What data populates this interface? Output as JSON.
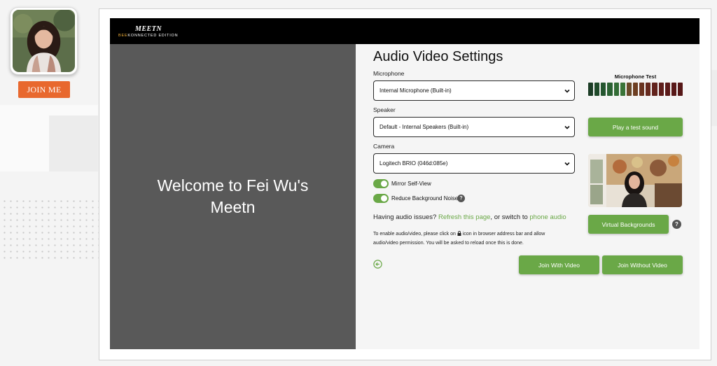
{
  "sidebar": {
    "join_me_label": "JOIN ME"
  },
  "header": {
    "logo_main": "MEETN",
    "logo_bee": "BEE",
    "logo_konnected": "KONNECTED",
    "logo_edition": " EDITION"
  },
  "welcome": {
    "text": "Welcome to Fei Wu's Meetn"
  },
  "settings": {
    "title": "Audio Video Settings",
    "microphone_label": "Microphone",
    "microphone_value": "Internal Microphone (Built-in)",
    "speaker_label": "Speaker",
    "speaker_value": "Default - Internal Speakers (Built-in)",
    "camera_label": "Camera",
    "camera_value": "Logitech BRIO (046d:085e)",
    "mirror_label": "Mirror Self-View",
    "mirror_on": true,
    "noise_label": "Reduce Background Noise",
    "noise_on": true,
    "help_glyph": "?",
    "issues_prefix": "Having audio issues?",
    "refresh_link": "Refresh this page",
    "issues_middle": ",  or switch to",
    "phone_link": "phone audio",
    "note_part1": "To enable audio/video, please click on",
    "note_part2": "icon in browser address bar and allow audio/video permission. You will be asked to reload once this is done."
  },
  "mic_test": {
    "title": "Microphone Test",
    "segments": [
      "#1c3d26",
      "#1f4a2a",
      "#24562f",
      "#2b6233",
      "#336d36",
      "#3a7438",
      "#6b4a2a",
      "#6e3f22",
      "#6a3320",
      "#66291e",
      "#62221c",
      "#5f1e1b",
      "#5b1a19",
      "#581818",
      "#561717"
    ]
  },
  "buttons": {
    "play_test_sound": "Play a test sound",
    "virtual_backgrounds": "Virtual Backgrounds",
    "join_with_video": "Join With Video",
    "join_without_video": "Join Without Video"
  },
  "colors": {
    "accent_green": "#6aa847",
    "join_orange": "#e8682e",
    "panel_gray": "#595959"
  }
}
